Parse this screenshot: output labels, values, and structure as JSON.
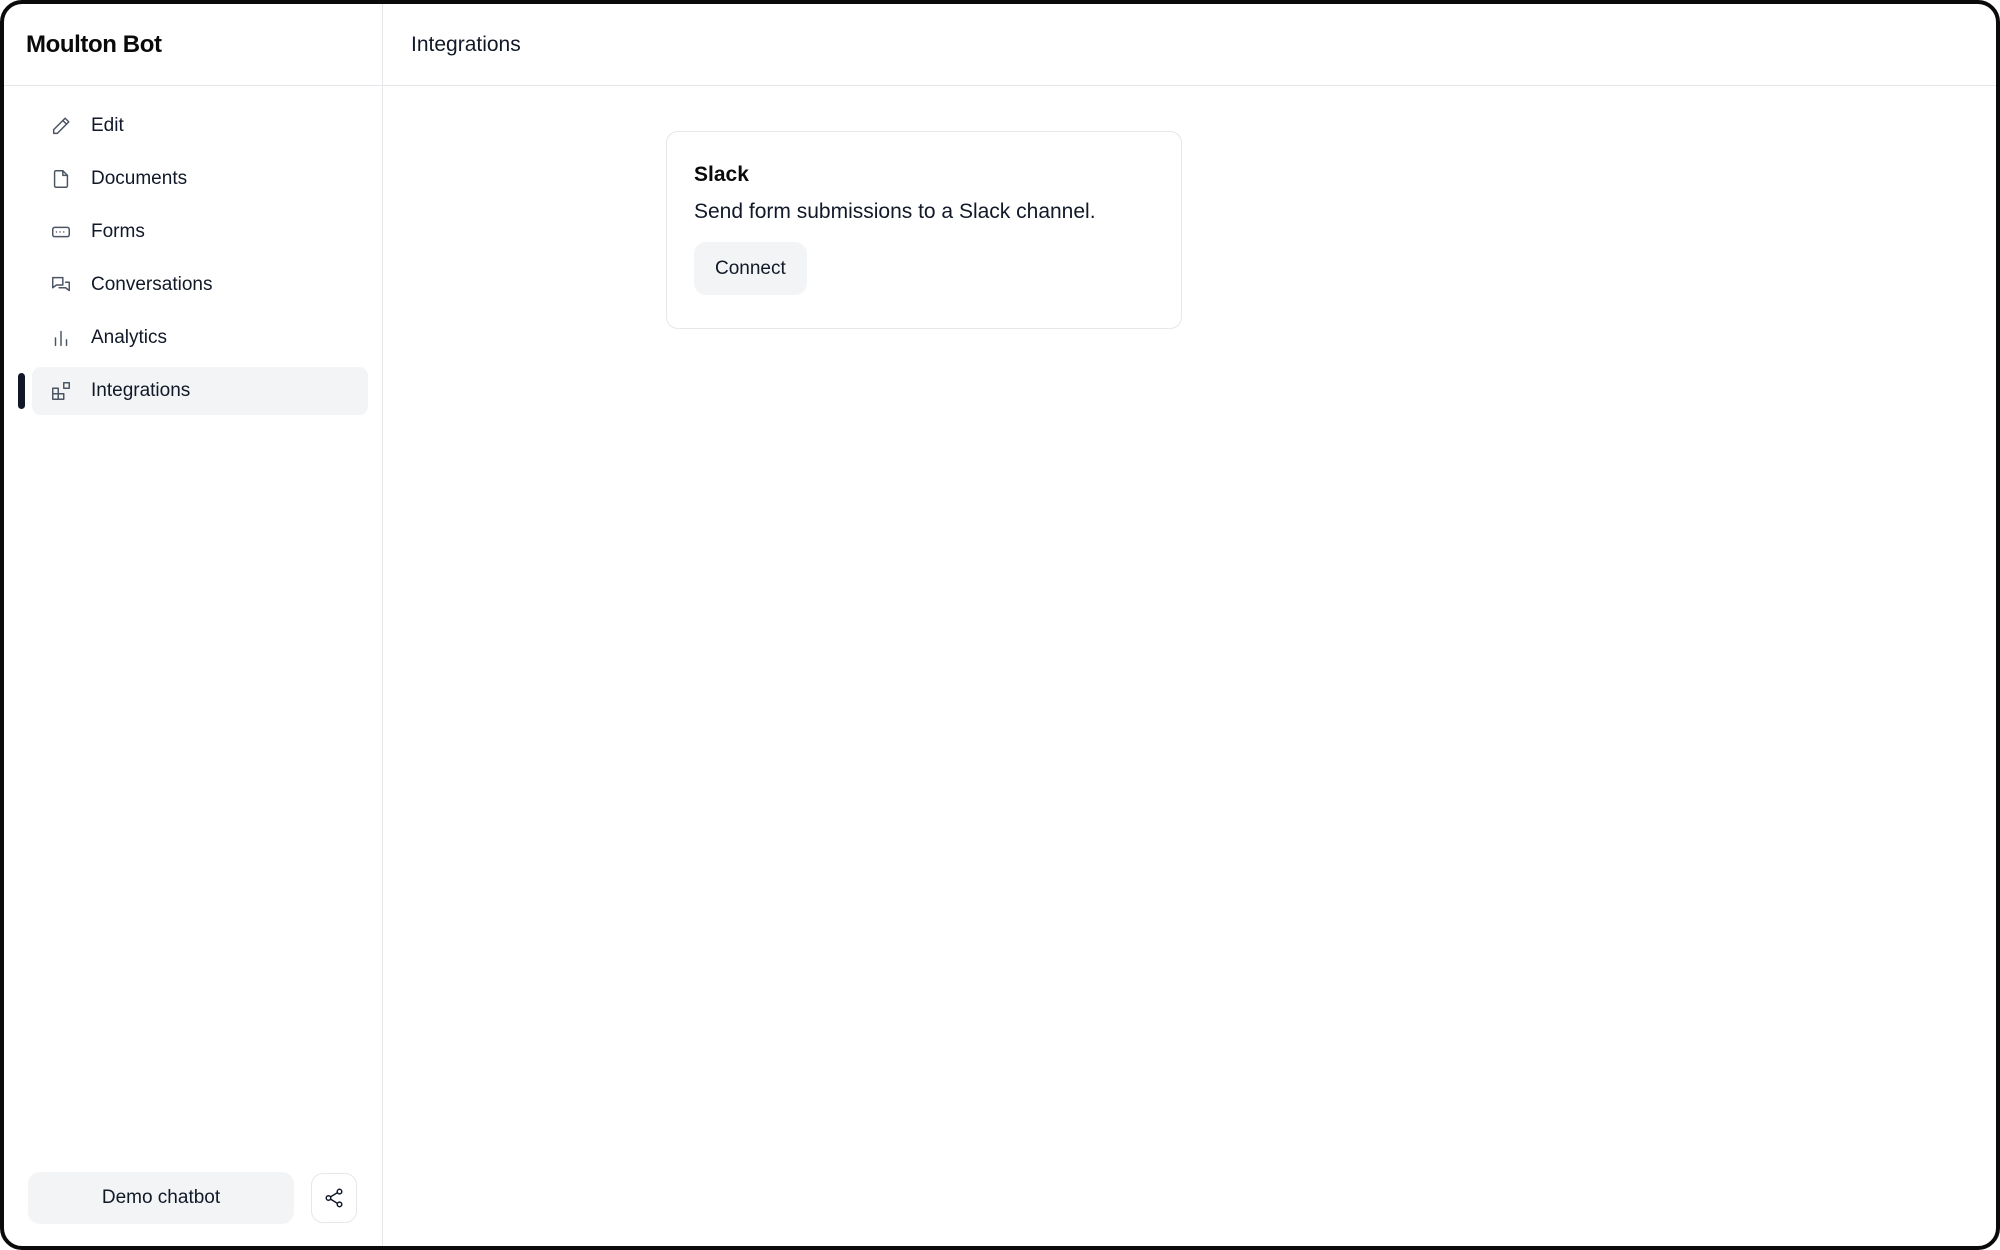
{
  "app": {
    "title": "Moulton Bot"
  },
  "header": {
    "title": "Integrations"
  },
  "sidebar": {
    "items": [
      {
        "label": "Edit",
        "icon": "pencil-icon",
        "active": false
      },
      {
        "label": "Documents",
        "icon": "document-icon",
        "active": false
      },
      {
        "label": "Forms",
        "icon": "form-icon",
        "active": false
      },
      {
        "label": "Conversations",
        "icon": "chat-icon",
        "active": false
      },
      {
        "label": "Analytics",
        "icon": "bar-chart-icon",
        "active": false
      },
      {
        "label": "Integrations",
        "icon": "integrations-icon",
        "active": true
      }
    ],
    "demo_button": "Demo chatbot",
    "share_icon": "share-icon"
  },
  "integrations": [
    {
      "name": "Slack",
      "description": "Send form submissions to a Slack channel.",
      "action_label": "Connect"
    }
  ]
}
